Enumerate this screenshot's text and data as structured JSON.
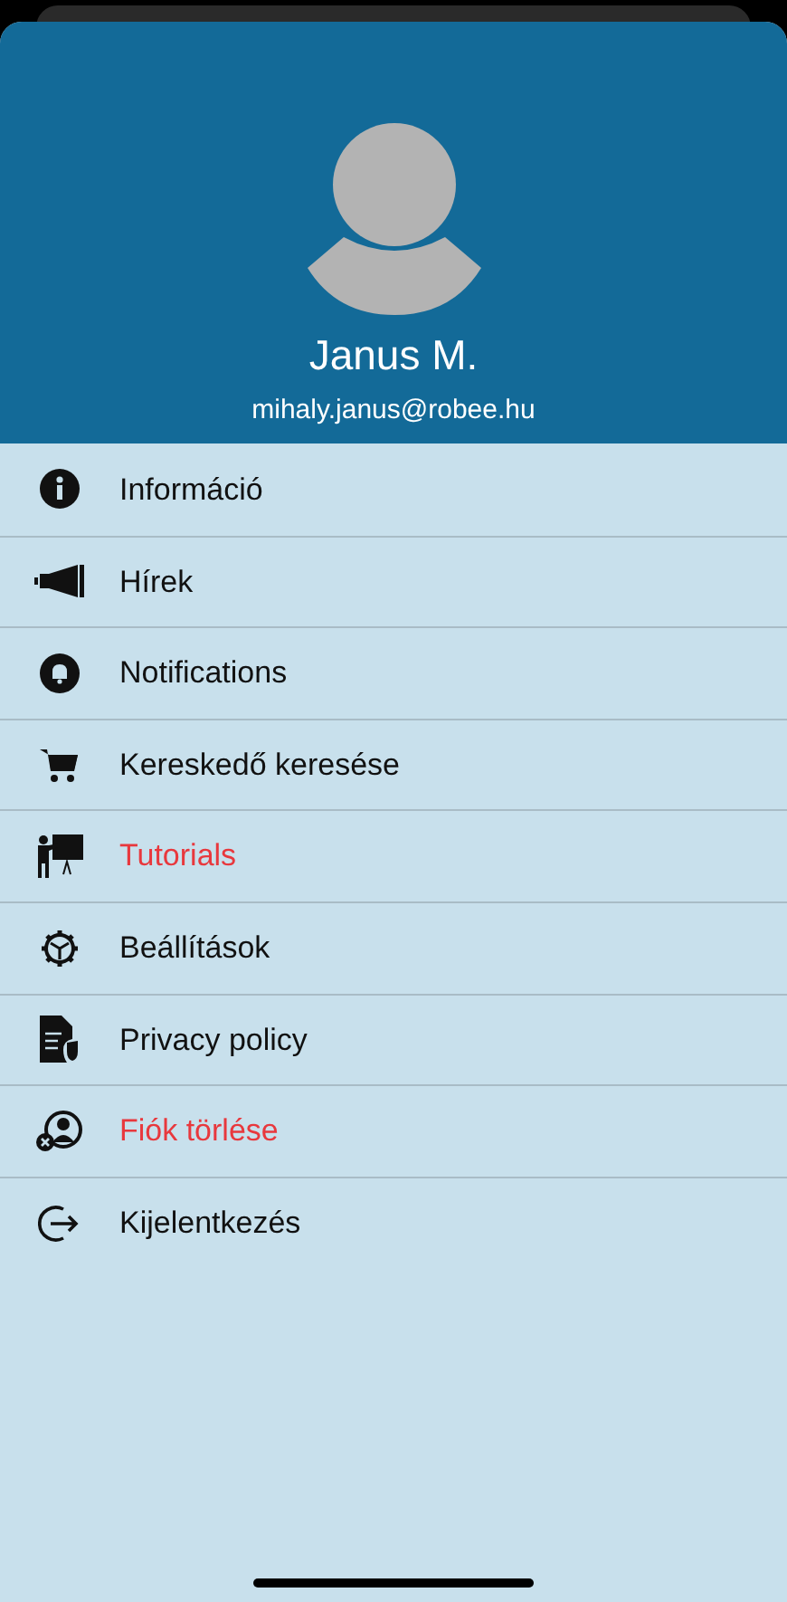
{
  "profile": {
    "name": "Janus M.",
    "email": "mihaly.janus@robee.hu"
  },
  "menu": [
    {
      "label": "Információ",
      "kind": "normal"
    },
    {
      "label": "Hírek",
      "kind": "normal"
    },
    {
      "label": "Notifications",
      "kind": "normal"
    },
    {
      "label": "Kereskedő keresése",
      "kind": "normal"
    },
    {
      "label": "Tutorials",
      "kind": "danger"
    },
    {
      "label": "Beállítások",
      "kind": "normal"
    },
    {
      "label": "Privacy policy",
      "kind": "normal"
    },
    {
      "label": "Fiók törlése",
      "kind": "danger"
    },
    {
      "label": "Kijelentkezés",
      "kind": "normal"
    }
  ]
}
